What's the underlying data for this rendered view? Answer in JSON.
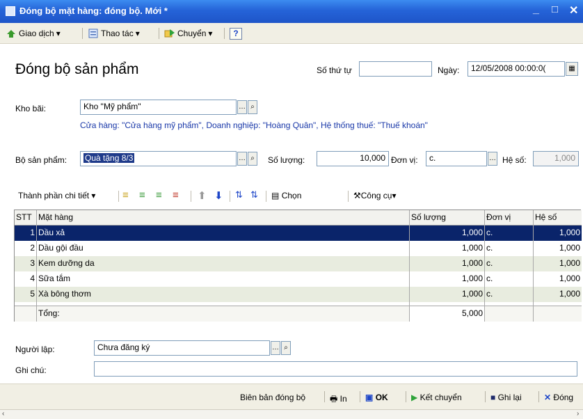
{
  "window": {
    "title": "Đóng bộ mặt hàng: đóng bộ. Mới *",
    "minimize": "_",
    "maximize": "□",
    "close": "✕"
  },
  "menu": {
    "transactions": "Giao dịch",
    "actions": "Thao tác",
    "transfer": "Chuyển",
    "help": "?"
  },
  "form": {
    "heading": "Đóng bộ sản phẩm",
    "number_label": "Số thứ tự",
    "number_value": "",
    "date_label": "Ngày:",
    "date_value": "12/05/2008 00:00:0(",
    "warehouse_label": "Kho bãi:",
    "warehouse_value": "Kho \"Mỹ phẩm\"",
    "warehouse_info": "Cửa hàng: \"Cửa hàng mỹ phẩm\", Doanh nghiệp: \"Hoàng Quân\", Hệ thống thuế: \"Thuế khoán\"",
    "product_set_label": "Bộ sản phẩm:",
    "product_set_value": "Quà tặng 8/3",
    "quantity_label": "Số lượng:",
    "quantity_value": "10,000",
    "unit_label": "Đơn vị:",
    "unit_value": "c.",
    "coef_label": "Hệ số:",
    "coef_value": "1,000",
    "creator_label": "Người lập:",
    "creator_value": "Chưa đăng ký",
    "note_label": "Ghi chú:",
    "note_value": ""
  },
  "detail_toolbar": {
    "details_label": "Thành phần chi tiết",
    "choose_label": "Chọn",
    "tools_label": "Công cụ"
  },
  "grid": {
    "headers": {
      "no": "STT",
      "item": "Mặt hàng",
      "qty": "Số lượng",
      "unit": "Đơn vị",
      "coef": "Hệ số"
    },
    "rows": [
      {
        "no": "1",
        "item": "Dầu xả",
        "qty": "1,000",
        "unit": "c.",
        "coef": "1,000"
      },
      {
        "no": "2",
        "item": "Dầu gội đầu",
        "qty": "1,000",
        "unit": "c.",
        "coef": "1,000"
      },
      {
        "no": "3",
        "item": "Kem dưỡng da",
        "qty": "1,000",
        "unit": "c.",
        "coef": "1,000"
      },
      {
        "no": "4",
        "item": "Sữa tắm",
        "qty": "1,000",
        "unit": "c.",
        "coef": "1,000"
      },
      {
        "no": "5",
        "item": "Xà bông thơm",
        "qty": "1,000",
        "unit": "c.",
        "coef": "1,000"
      }
    ],
    "total_label": "Tổng:",
    "total_qty": "5,000"
  },
  "footer": {
    "report": "Biên bản đóng bộ",
    "print": "In",
    "ok": "OK",
    "transfer": "Kết chuyển",
    "save": "Ghi lại",
    "close": "Đóng"
  }
}
